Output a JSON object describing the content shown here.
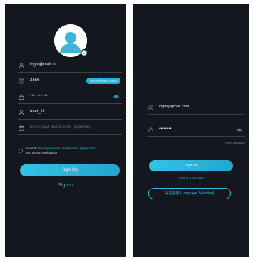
{
  "register": {
    "email_value": "login@mail.ru",
    "code_value": "2356",
    "code_button": "Get verification code",
    "password_value": "••••••••••",
    "username_value": "user_111",
    "invite_placeholder": "Enter your invite code (optional)",
    "agree_prefix": "Accept ",
    "agree_link1": "user agreement",
    "agree_sep": ", ",
    "agree_link2": "user private agreement",
    "agree_suffix": "and do the registration",
    "signup_label": "Sign Up",
    "signin_label": "Sign in"
  },
  "login": {
    "email_value": "login@gmail.com",
    "password_value": "••••••••",
    "forgot_label": "Forgot password",
    "signin_label": "Sign in",
    "create_label": "Create a account",
    "language_label": "语言选择 (Language Selection)"
  },
  "colors": {
    "background": "#14171e",
    "accent": "#2fb6dc"
  }
}
